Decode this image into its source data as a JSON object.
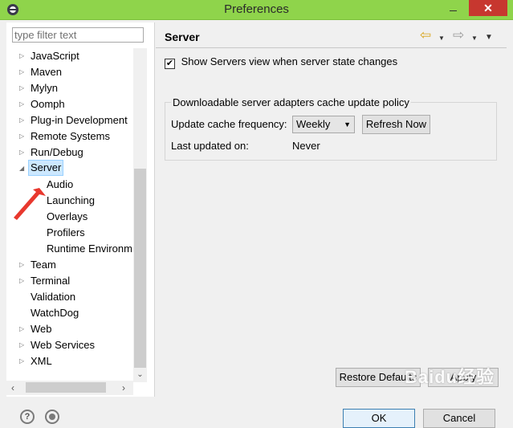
{
  "window": {
    "title": "Preferences",
    "close_glyph": "✕"
  },
  "left": {
    "filter_placeholder": "type filter text",
    "tree": [
      {
        "label": "JavaScript",
        "expander": "▷"
      },
      {
        "label": "Maven",
        "expander": "▷"
      },
      {
        "label": "Mylyn",
        "expander": "▷"
      },
      {
        "label": "Oomph",
        "expander": "▷"
      },
      {
        "label": "Plug-in Development",
        "expander": "▷"
      },
      {
        "label": "Remote Systems",
        "expander": "▷"
      },
      {
        "label": "Run/Debug",
        "expander": "▷"
      },
      {
        "label": "Server",
        "expander": "◢",
        "selected": true
      },
      {
        "label": "Audio",
        "expander": ""
      },
      {
        "label": "Launching",
        "expander": ""
      },
      {
        "label": "Overlays",
        "expander": ""
      },
      {
        "label": "Profilers",
        "expander": ""
      },
      {
        "label": "Runtime Environm",
        "expander": ""
      },
      {
        "label": "Team",
        "expander": "▷"
      },
      {
        "label": "Terminal",
        "expander": "▷"
      },
      {
        "label": "Validation",
        "expander": ""
      },
      {
        "label": "WatchDog",
        "expander": ""
      },
      {
        "label": "Web",
        "expander": "▷"
      },
      {
        "label": "Web Services",
        "expander": "▷"
      },
      {
        "label": "XML",
        "expander": "▷"
      }
    ]
  },
  "right": {
    "title": "Server",
    "show_servers_label": "Show Servers view when server state changes",
    "show_servers_checked": true,
    "group_title": "Downloadable server adapters cache update policy",
    "update_freq_label": "Update cache frequency:",
    "update_freq_value": "Weekly",
    "refresh_label": "Refresh Now",
    "last_updated_label": "Last updated on:",
    "last_updated_value": "Never",
    "restore_label": "Restore Defaults",
    "apply_label": "Apply"
  },
  "footer": {
    "ok_label": "OK",
    "cancel_label": "Cancel",
    "help_glyph": "?"
  },
  "watermark": "Baidu经验",
  "colors": {
    "titlebar": "#8fd44b",
    "selection": "#cce8ff",
    "annotation_arrow": "#e8382e"
  }
}
